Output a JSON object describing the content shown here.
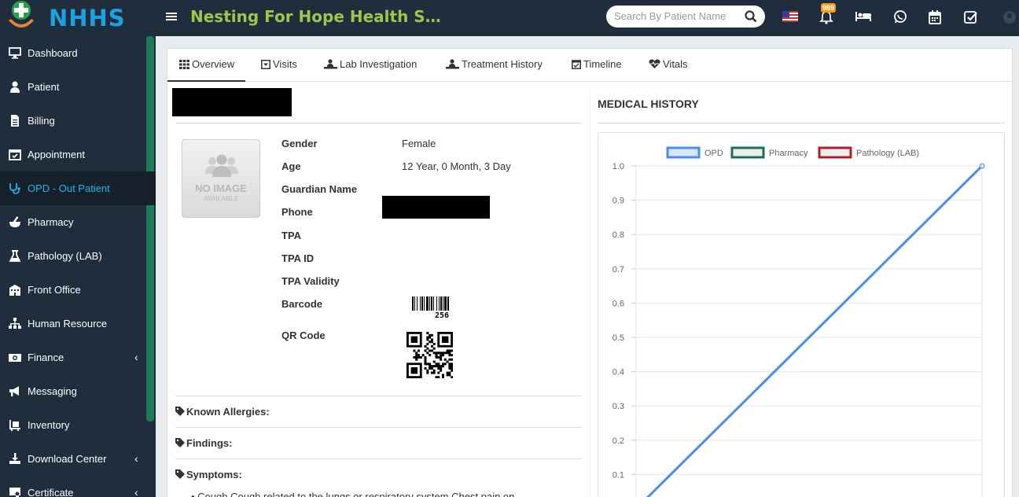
{
  "header": {
    "logo_text": "NHHS",
    "app_title": "Nesting For Hope Health Serv…",
    "search_placeholder": "Search By Patient Name",
    "notification_count": "989"
  },
  "sidebar": {
    "items": [
      {
        "label": "Dashboard",
        "icon": "desktop-icon",
        "chevron": false
      },
      {
        "label": "Patient",
        "icon": "user-icon",
        "chevron": false
      },
      {
        "label": "Billing",
        "icon": "file-icon",
        "chevron": false
      },
      {
        "label": "Appointment",
        "icon": "calendar-check-icon",
        "chevron": false
      },
      {
        "label": "OPD - Out Patient",
        "icon": "stethoscope-icon",
        "chevron": false,
        "active": true
      },
      {
        "label": "Pharmacy",
        "icon": "mortar-pestle-icon",
        "chevron": false
      },
      {
        "label": "Pathology (LAB)",
        "icon": "flask-icon",
        "chevron": false
      },
      {
        "label": "Front Office",
        "icon": "building-icon",
        "chevron": false
      },
      {
        "label": "Human Resource",
        "icon": "sitemap-icon",
        "chevron": false
      },
      {
        "label": "Finance",
        "icon": "money-icon",
        "chevron": true
      },
      {
        "label": "Messaging",
        "icon": "bullhorn-icon",
        "chevron": false
      },
      {
        "label": "Inventory",
        "icon": "dolly-icon",
        "chevron": false
      },
      {
        "label": "Download Center",
        "icon": "download-icon",
        "chevron": true
      },
      {
        "label": "Certificate",
        "icon": "certificate-icon",
        "chevron": true
      }
    ]
  },
  "tabs": [
    {
      "label": "Overview",
      "icon": "grid-icon",
      "active": true
    },
    {
      "label": "Visits",
      "icon": "caret-square-icon"
    },
    {
      "label": "Lab Investigation",
      "icon": "lab-icon"
    },
    {
      "label": "Treatment History",
      "icon": "procedure-icon"
    },
    {
      "label": "Timeline",
      "icon": "calendar-check-icon"
    },
    {
      "label": "Vitals",
      "icon": "heartbeat-icon"
    }
  ],
  "patient": {
    "avatar_line1": "NO IMAGE",
    "avatar_line2": "AVAILABLE",
    "fields": {
      "gender_label": "Gender",
      "gender_value": "Female",
      "age_label": "Age",
      "age_value": "12 Year, 0 Month, 3 Day",
      "guardian_label": "Guardian Name",
      "phone_label": "Phone",
      "tpa_label": "TPA",
      "tpa_id_label": "TPA ID",
      "tpa_validity_label": "TPA Validity",
      "barcode_label": "Barcode",
      "barcode_value": "256",
      "qr_label": "QR Code"
    },
    "sections": {
      "allergies": "Known Allergies:",
      "findings": "Findings:",
      "symptoms": "Symptoms:",
      "symptom_text": "Cough Cough related to the lungs or respiratory system Chest pain on"
    }
  },
  "medical_history": {
    "title": "MEDICAL HISTORY"
  },
  "colors": {
    "opd": "#4a8df0",
    "pharmacy": "#1e6e57",
    "pathology": "#b21e2a"
  },
  "chart_data": {
    "type": "line",
    "title": "",
    "xlabel": "",
    "ylabel": "",
    "ylim": [
      0,
      1.0
    ],
    "yticks": [
      "1.0",
      "0.9",
      "0.8",
      "0.7",
      "0.6",
      "0.5",
      "0.4",
      "0.3",
      "0.2",
      "0.1"
    ],
    "legend_position": "top",
    "series": [
      {
        "name": "OPD",
        "x": [
          0,
          1
        ],
        "values": [
          0,
          1.0
        ]
      },
      {
        "name": "Pharmacy",
        "x": [],
        "values": []
      },
      {
        "name": "Pathology (LAB)",
        "x": [],
        "values": []
      }
    ],
    "grid": true
  }
}
